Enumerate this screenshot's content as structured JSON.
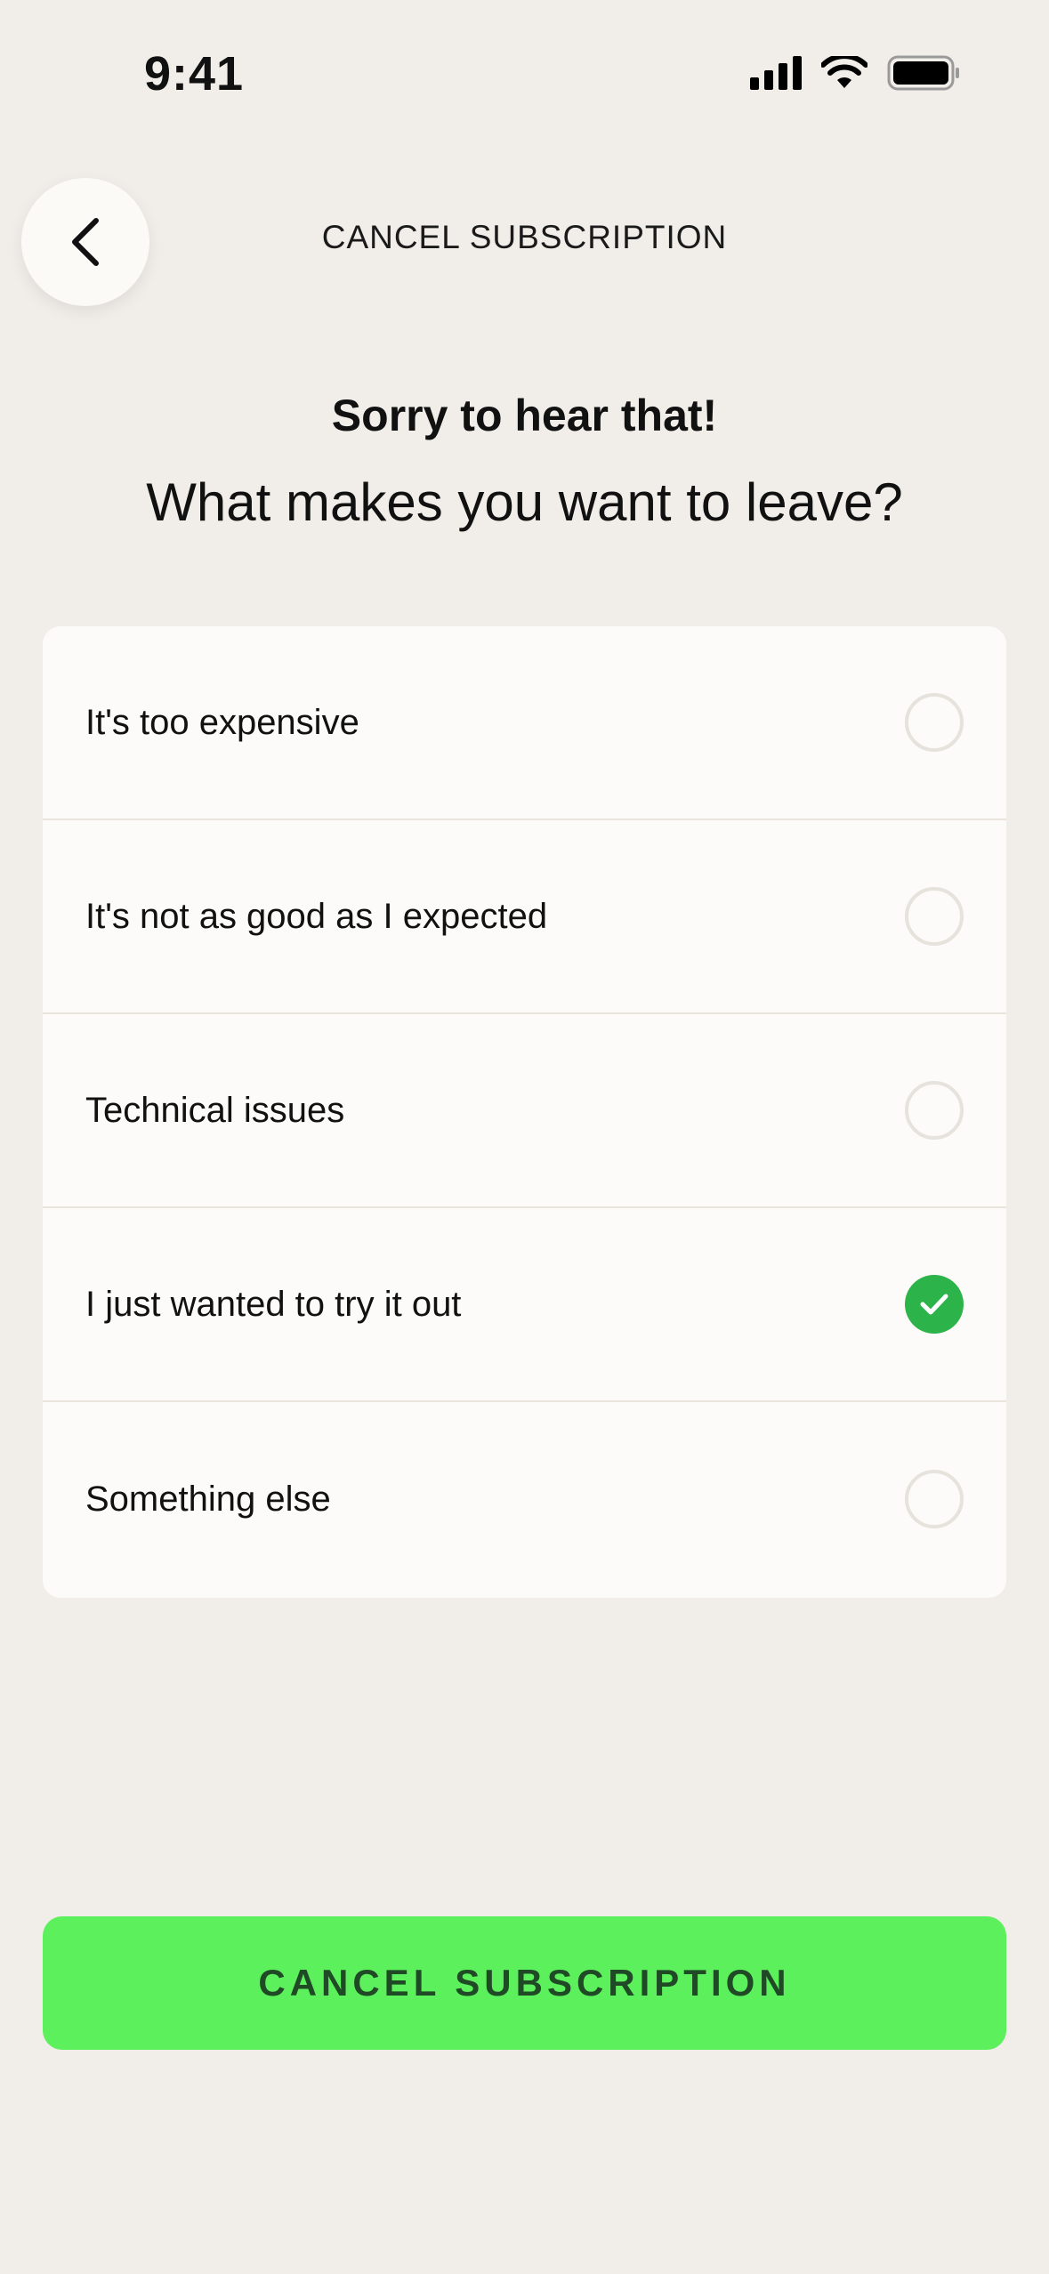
{
  "status_bar": {
    "time": "9:41",
    "icons": [
      "cellular-signal-icon",
      "wifi-icon",
      "battery-icon"
    ]
  },
  "nav": {
    "back_icon": "chevron-left-icon",
    "title": "CANCEL SUBSCRIPTION"
  },
  "header": {
    "subtitle": "Sorry to hear that!",
    "question": "What makes you want to leave?"
  },
  "options": [
    {
      "label": "It's too expensive",
      "selected": false
    },
    {
      "label": "It's not as good as I expected",
      "selected": false
    },
    {
      "label": "Technical issues",
      "selected": false
    },
    {
      "label": "I just wanted to try it out",
      "selected": true
    },
    {
      "label": "Something else",
      "selected": false
    }
  ],
  "cta": {
    "label": "CANCEL SUBSCRIPTION"
  },
  "colors": {
    "background": "#f1eee9",
    "card": "#fcfbf9",
    "accent_green": "#5cf05c",
    "check_green": "#2cb34a",
    "cta_text": "#1f4a25"
  }
}
